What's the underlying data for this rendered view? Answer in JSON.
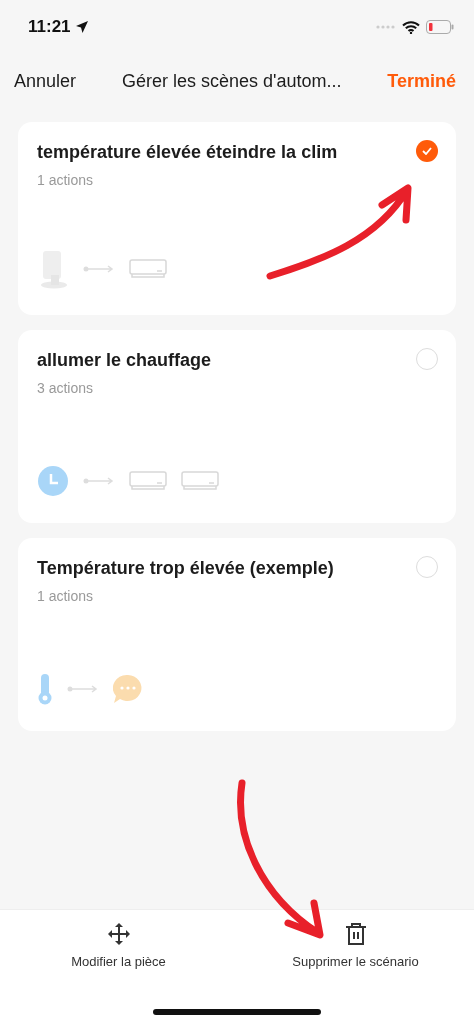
{
  "status_bar": {
    "time": "11:21"
  },
  "nav_bar": {
    "cancel": "Annuler",
    "title": "Gérer les scènes d'autom...",
    "done": "Terminé"
  },
  "scenes": [
    {
      "title": "température élevée éteindre la clim",
      "subtitle": "1 actions",
      "selected": true,
      "trigger": {
        "kind": "sensor"
      },
      "actions": [
        {
          "kind": "ac"
        }
      ]
    },
    {
      "title": "allumer le chauffage",
      "subtitle": "3 actions",
      "selected": false,
      "trigger": {
        "kind": "clock"
      },
      "actions": [
        {
          "kind": "ac"
        },
        {
          "kind": "ac"
        }
      ]
    },
    {
      "title": "Température trop élevée (exemple)",
      "subtitle": "1 actions",
      "selected": false,
      "trigger": {
        "kind": "thermometer"
      },
      "actions": [
        {
          "kind": "message"
        }
      ]
    }
  ],
  "bottom_bar": [
    {
      "kind": "move",
      "label": "Modifier la pièce"
    },
    {
      "kind": "delete",
      "label": "Supprimer le scénario"
    }
  ]
}
